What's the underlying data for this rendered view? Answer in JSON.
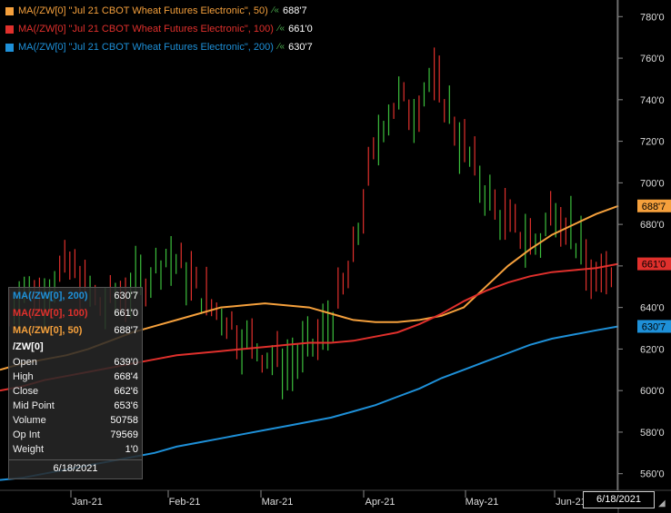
{
  "legend": [
    {
      "label": "MA(/ZW[0] \"Jul 21 CBOT Wheat Futures Electronic\", 50)",
      "value": "688'7",
      "color": "#f5a03c"
    },
    {
      "label": "MA(/ZW[0] \"Jul 21 CBOT Wheat Futures Electronic\", 100)",
      "value": "661'0",
      "color": "#e0302c"
    },
    {
      "label": "MA(/ZW[0] \"Jul 21 CBOT Wheat Futures Electronic\", 200)",
      "value": "630'7",
      "color": "#1e90d8"
    }
  ],
  "tooltip": {
    "ma200_label": "MA(/ZW[0], 200)",
    "ma200_value": "630'7",
    "ma100_label": "MA(/ZW[0], 100)",
    "ma100_value": "661'0",
    "ma50_label": "MA(/ZW[0], 50)",
    "ma50_value": "688'7",
    "symbol": "/ZW[0]",
    "rows": [
      {
        "label": "Open",
        "value": "639'0"
      },
      {
        "label": "High",
        "value": "668'4"
      },
      {
        "label": "Close",
        "value": "662'6"
      },
      {
        "label": "Mid Point",
        "value": "653'6"
      },
      {
        "label": "Volume",
        "value": "50758"
      },
      {
        "label": "Op Int",
        "value": "79569"
      },
      {
        "label": "Weight",
        "value": "1'0"
      }
    ],
    "date": "6/18/2021"
  },
  "cursor_date": "6/18/2021",
  "chart_data": {
    "type": "line",
    "title": "",
    "y_range": [
      552,
      788
    ],
    "y_ticks": [
      {
        "value": 560,
        "label": "560'0"
      },
      {
        "value": 580,
        "label": "580'0"
      },
      {
        "value": 600,
        "label": "600'0"
      },
      {
        "value": 620,
        "label": "620'0"
      },
      {
        "value": 640,
        "label": "640'0"
      },
      {
        "value": 660,
        "label": "660'0"
      },
      {
        "value": 680,
        "label": "680'0"
      },
      {
        "value": 700,
        "label": "700'0"
      },
      {
        "value": 720,
        "label": "720'0"
      },
      {
        "value": 740,
        "label": "740'0"
      },
      {
        "value": 760,
        "label": "760'0"
      },
      {
        "value": 780,
        "label": "780'0"
      }
    ],
    "x_ticks": [
      "Jan-21",
      "Feb-21",
      "Mar-21",
      "Apr-21",
      "May-21",
      "Jun-21"
    ],
    "last_value_tags": [
      {
        "label": "688'7",
        "value": 688.9,
        "color": "#f5a03c"
      },
      {
        "label": "661'0",
        "value": 661.0,
        "color": "#e0302c"
      },
      {
        "label": "630'7",
        "value": 630.9,
        "color": "#1e90d8"
      }
    ],
    "series": [
      {
        "name": "MA(/ZW[0] \"Jul 21 CBOT Wheat Futures Electronic\", 50)",
        "color": "#f5a03c",
        "values": [
          610,
          613,
          615,
          617,
          620,
          624,
          628,
          631,
          634,
          637,
          640,
          641,
          642,
          641,
          640,
          637,
          634,
          633,
          633,
          634,
          636,
          640,
          650,
          660,
          668,
          675,
          680,
          685,
          688.9
        ]
      },
      {
        "name": "MA(/ZW[0] \"Jul 21 CBOT Wheat Futures Electronic\", 100)",
        "color": "#e0302c",
        "values": [
          600,
          602,
          605,
          607,
          609,
          611,
          613,
          615,
          617,
          618,
          619,
          620,
          621,
          622,
          623,
          623,
          624,
          626,
          628,
          632,
          637,
          643,
          648,
          652,
          655,
          657,
          658,
          659,
          661.0
        ]
      },
      {
        "name": "MA(/ZW[0] \"Jul 21 CBOT Wheat Futures Electronic\", 200)",
        "color": "#1e90d8",
        "values": [
          557,
          558,
          560,
          562,
          564,
          566,
          568,
          570,
          573,
          575,
          577,
          579,
          581,
          583,
          585,
          587,
          590,
          593,
          597,
          601,
          606,
          610,
          614,
          618,
          622,
          625,
          627,
          629,
          630.9
        ]
      }
    ]
  }
}
